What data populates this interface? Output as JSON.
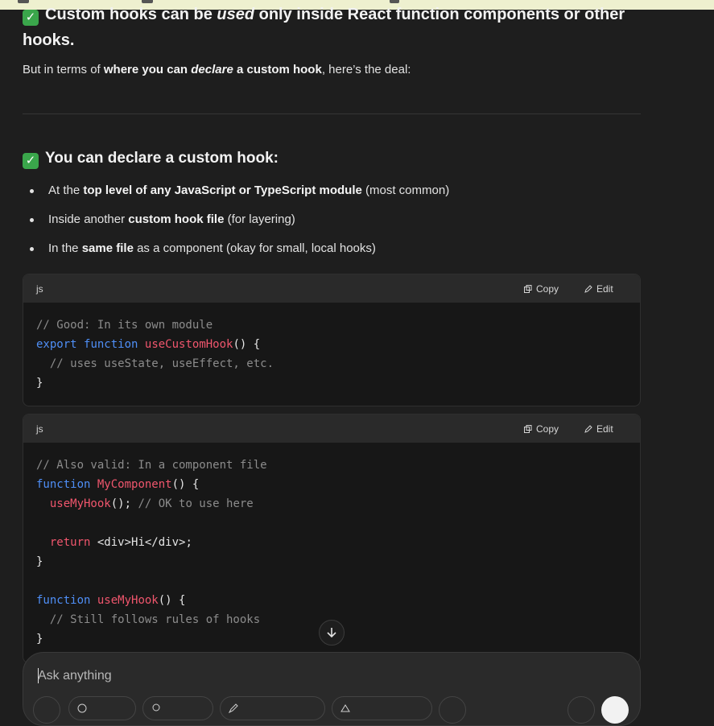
{
  "heading_top": {
    "check": "✓",
    "part1": "Custom hooks can be ",
    "emph": "used",
    "part2": " only inside React function components or other hooks."
  },
  "intro": {
    "pre": "But in terms of ",
    "bold1": "where you can ",
    "ital": "declare",
    "bold2": " a custom hook",
    "post": ", here’s the deal:"
  },
  "section": {
    "check": "✓",
    "title": "You can declare a custom hook:"
  },
  "bullets": [
    {
      "pre": "At the ",
      "bold": "top level of any JavaScript or TypeScript module",
      "post": " (most common)"
    },
    {
      "pre": "Inside another ",
      "bold": "custom hook file",
      "post": " (for layering)"
    },
    {
      "pre": "In the ",
      "bold": "same file",
      "post": " as a component (okay for small, local hooks)"
    }
  ],
  "code_blocks": [
    {
      "lang": "js",
      "copy_label": "Copy",
      "edit_label": "Edit",
      "lines": [
        [
          {
            "t": "// Good: In its own module",
            "c": "comment"
          }
        ],
        [
          {
            "t": "export",
            "c": "kw"
          },
          {
            "t": " ",
            "c": ""
          },
          {
            "t": "function",
            "c": "kw"
          },
          {
            "t": " ",
            "c": ""
          },
          {
            "t": "useCustomHook",
            "c": "fn"
          },
          {
            "t": "() {",
            "c": ""
          }
        ],
        [
          {
            "t": "  // uses useState, useEffect, etc.",
            "c": "comment"
          }
        ],
        [
          {
            "t": "}",
            "c": ""
          }
        ]
      ]
    },
    {
      "lang": "js",
      "copy_label": "Copy",
      "edit_label": "Edit",
      "lines": [
        [
          {
            "t": "// Also valid: In a component file",
            "c": "comment"
          }
        ],
        [
          {
            "t": "function",
            "c": "kw"
          },
          {
            "t": " ",
            "c": ""
          },
          {
            "t": "MyComponent",
            "c": "fn"
          },
          {
            "t": "() {",
            "c": ""
          }
        ],
        [
          {
            "t": "  ",
            "c": ""
          },
          {
            "t": "useMyHook",
            "c": "fn"
          },
          {
            "t": "(); ",
            "c": ""
          },
          {
            "t": "// OK to use here",
            "c": "comment"
          }
        ],
        [
          {
            "t": "",
            "c": ""
          }
        ],
        [
          {
            "t": "  ",
            "c": ""
          },
          {
            "t": "return",
            "c": "fn"
          },
          {
            "t": " <div>Hi</div>;",
            "c": ""
          }
        ],
        [
          {
            "t": "}",
            "c": ""
          }
        ],
        [
          {
            "t": "",
            "c": ""
          }
        ],
        [
          {
            "t": "function",
            "c": "kw"
          },
          {
            "t": " ",
            "c": ""
          },
          {
            "t": "useMyHook",
            "c": "fn"
          },
          {
            "t": "() {",
            "c": ""
          }
        ],
        [
          {
            "t": "  // Still follows rules of hooks",
            "c": "comment"
          }
        ],
        [
          {
            "t": "}",
            "c": ""
          }
        ]
      ]
    }
  ],
  "composer": {
    "placeholder": "Ask anything",
    "tools": [
      "plus-icon",
      "globe-icon",
      "lightbulb-icon",
      "pen-icon",
      "paint-icon",
      "more-icon",
      "mic-icon",
      "send-icon"
    ]
  },
  "colors": {
    "background": "#1e1e1e",
    "code_bg": "#171717",
    "keyword": "#4f8ff7",
    "function": "#f0566d",
    "comment": "#8c8c8c",
    "check": "#3aa64b"
  }
}
